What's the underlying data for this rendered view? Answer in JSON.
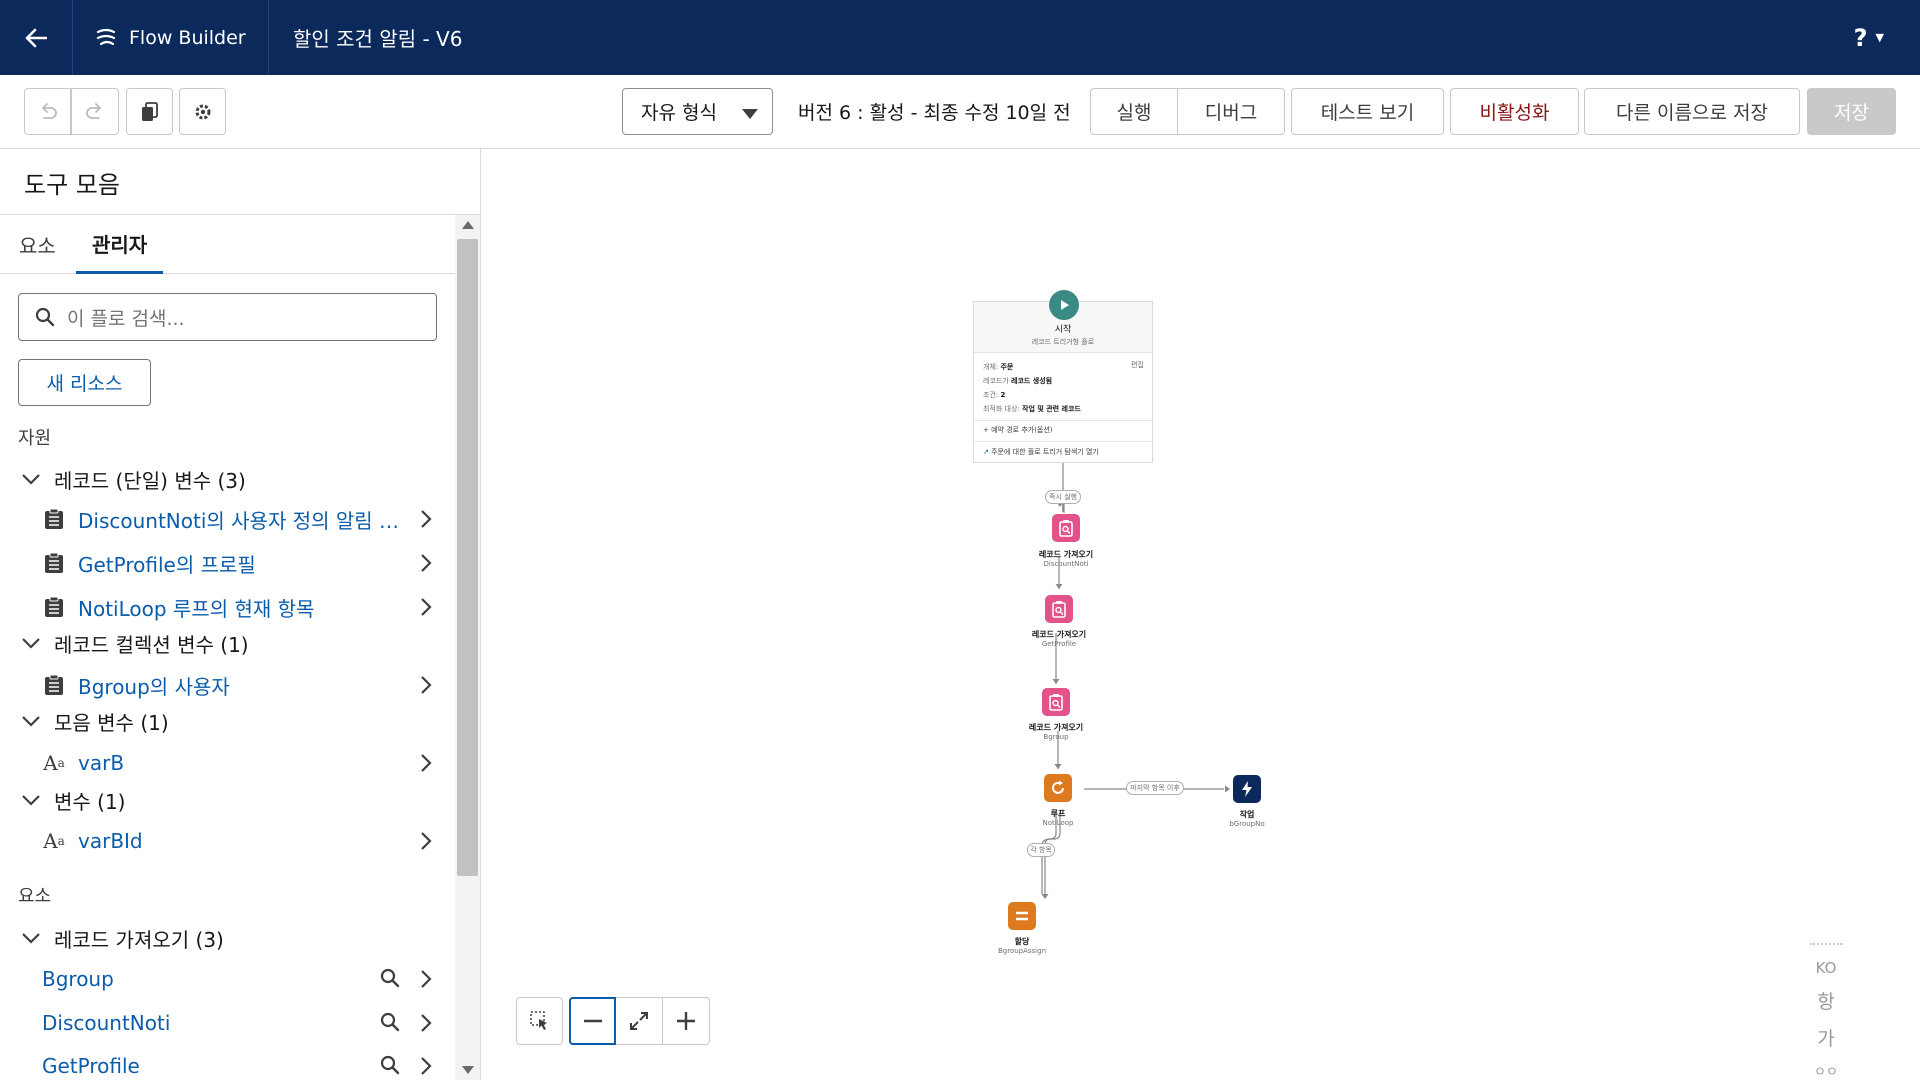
{
  "nav": {
    "app_name": "Flow Builder",
    "flow_title": "할인 조건 알림 - V6",
    "help": "?"
  },
  "toolbar": {
    "layout_select": "자유 형식",
    "version_info": "버전 6 : 활성 - 최종 수정 10일 전",
    "run": "실행",
    "debug": "디버그",
    "view_tests": "테스트 보기",
    "deactivate": "비활성화",
    "save_as": "다른 이름으로 저장",
    "save": "저장"
  },
  "panel": {
    "title": "도구 모음",
    "tabs": [
      "요소",
      "관리자"
    ],
    "search_placeholder": "이 플로 검색...",
    "new_resource": "새 리소스",
    "resources_heading": "자원",
    "groups": {
      "record_single": "레코드 (단일) 변수 (3)",
      "record_collection": "레코드 컬렉션 변수 (1)",
      "collection_vars": "모음 변수 (1)",
      "vars": "변수 (1)"
    },
    "items": {
      "r1": "DiscountNoti의 사용자 정의 알림 유형",
      "r2": "GetProfile의 프로필",
      "r3": "NotiLoop 루프의 현재 항목",
      "c1": "Bgroup의 사용자",
      "v1": "varB",
      "v2": "varBId"
    },
    "text_icon": "A",
    "text_icon_sub": "a",
    "elements_heading": "요소",
    "get_records_group": "레코드 가져오기 (3)",
    "elements": [
      "Bgroup",
      "DiscountNoti",
      "GetProfile"
    ]
  },
  "canvas": {
    "start": {
      "title": "시작",
      "subtitle": "레코드 트리거형 플로",
      "object_label": "개체:",
      "object_value": "주문",
      "edit": "편집",
      "trigger_label": "레코드가",
      "trigger_value": "레코드 생성됨",
      "cond_label": "조건:",
      "cond_value": "2",
      "optimize_label": "최적화 대상:",
      "optimize_value": "작업 및 관련 레코드",
      "add_path": "예약 경로 추가(옵션)",
      "open_explorer": "주문에 대한 플로 트리거 탐색기 열기"
    },
    "run_now": "즉시 실행",
    "nodes": [
      {
        "type": "레코드 가져오기",
        "name": "DiscountNoti"
      },
      {
        "type": "레코드 가져오기",
        "name": "GetProfile"
      },
      {
        "type": "레코드 가져오기",
        "name": "Bgroup"
      },
      {
        "type": "루프",
        "name": "NotiLoop"
      },
      {
        "type": "작업",
        "name": "bGroupNo"
      },
      {
        "type": "할당",
        "name": "BgroupAssign"
      }
    ],
    "after_last": "마지막 항목 이후",
    "for_each": "각 항목",
    "lang_switch": [
      "KO",
      "항",
      "가",
      "ㅇㅇ"
    ]
  },
  "colors": {
    "nav_bg": "#0b2a5b",
    "start_green": "#3b8a84",
    "get_records_pink": "#e3528a",
    "loop_orange": "#dd7a1f",
    "action_navy": "#0b2a5b",
    "link_blue": "#0b5cab",
    "deactivate_red": "#8c1414"
  }
}
